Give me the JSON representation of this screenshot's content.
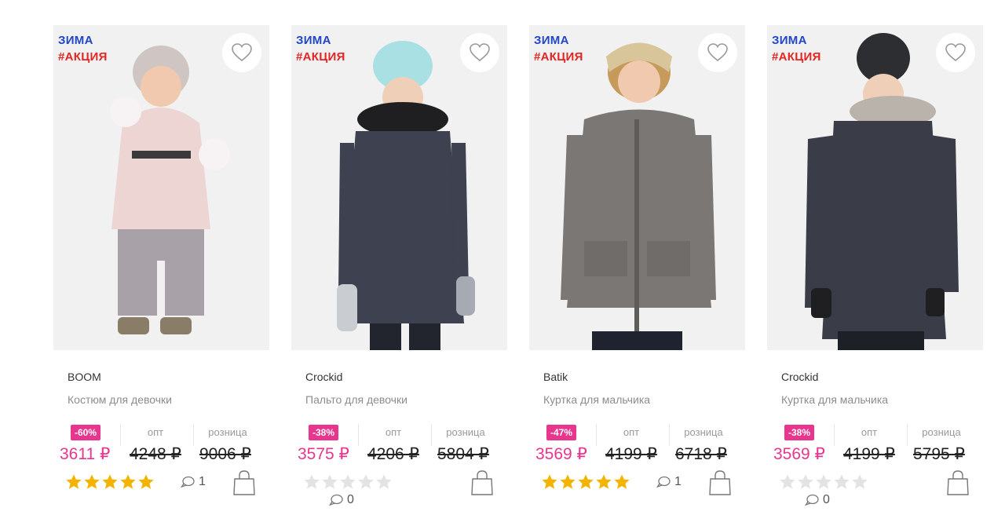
{
  "colors": {
    "accent": "#e8368f",
    "season": "#2146c7",
    "promo": "#e52521",
    "star_on": "#f5b301",
    "star_off": "#e3e3e3"
  },
  "labels": {
    "wholesale": "опт",
    "retail": "розница"
  },
  "products": [
    {
      "season": "ЗИМА",
      "promo": "#АКЦИЯ",
      "brand": "BOOM",
      "description": "Костюм для девочки",
      "discount": "-60%",
      "price": "3611 ₽",
      "wholesale": "4248 ₽",
      "retail": "9006 ₽",
      "rating": 5,
      "comments": "1"
    },
    {
      "season": "ЗИМА",
      "promo": "#АКЦИЯ",
      "brand": "Crockid",
      "description": "Пальто для девочки",
      "discount": "-38%",
      "price": "3575 ₽",
      "wholesale": "4206 ₽",
      "retail": "5804 ₽",
      "rating": 0,
      "comments": "0"
    },
    {
      "season": "ЗИМА",
      "promo": "#АКЦИЯ",
      "brand": "Batik",
      "description": "Куртка для мальчика",
      "discount": "-47%",
      "price": "3569 ₽",
      "wholesale": "4199 ₽",
      "retail": "6718 ₽",
      "rating": 5,
      "comments": "1"
    },
    {
      "season": "ЗИМА",
      "promo": "#АКЦИЯ",
      "brand": "Crockid",
      "description": "Куртка для мальчика",
      "discount": "-38%",
      "price": "3569 ₽",
      "wholesale": "4199 ₽",
      "retail": "5795 ₽",
      "rating": 0,
      "comments": "0"
    }
  ]
}
